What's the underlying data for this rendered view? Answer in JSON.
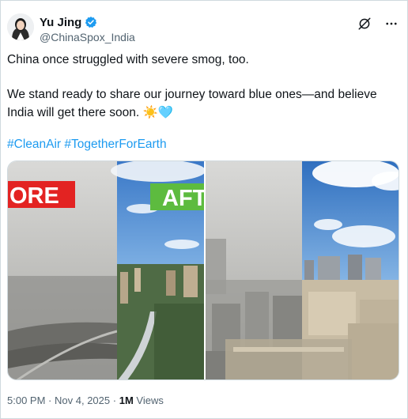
{
  "author": {
    "display_name": "Yu Jing",
    "handle": "@ChinaSpox_India"
  },
  "post": {
    "line1": "China once struggled with severe smog, too.",
    "line2": "We stand ready to share our journey toward blue ones—and  believe India will get there soon.",
    "emoji_sun": "☀️",
    "emoji_heart": "🩵",
    "hashtag1": "#CleanAir",
    "hashtag2": "#TogetherForEarth"
  },
  "media": {
    "label_before": "ORE",
    "label_after": "AFT"
  },
  "meta": {
    "time": "5:00 PM",
    "date": "Nov 4, 2025",
    "views_count": "1M",
    "views_label": "Views"
  },
  "icons": {
    "verified": "verified-badge-icon",
    "grok": "grok-icon",
    "more": "more-icon"
  },
  "colors": {
    "link": "#1d9bf0",
    "verified": "#1d9bf0",
    "label_red": "#e32322",
    "label_green": "#5dbb3f",
    "secondary_text": "#536471"
  }
}
